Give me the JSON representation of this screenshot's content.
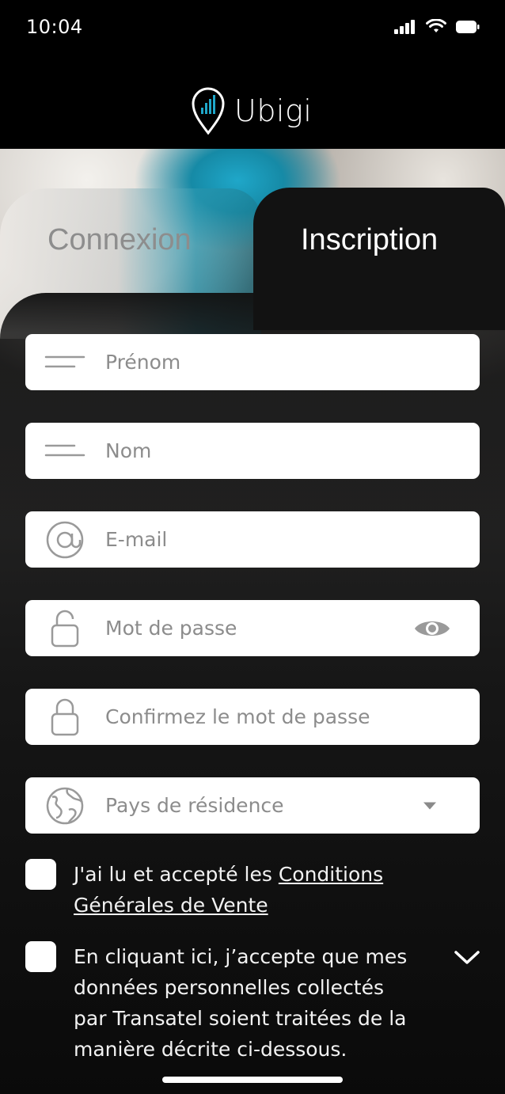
{
  "status_bar": {
    "time": "10:04",
    "icons": [
      "signal-icon",
      "wifi-icon",
      "battery-icon"
    ]
  },
  "header": {
    "logo_text": "Ubigi",
    "logo_icon": "location-pin-signal-icon"
  },
  "tabs": [
    {
      "label": "Connexion",
      "active": false
    },
    {
      "label": "Inscription",
      "active": true
    }
  ],
  "form": {
    "first_name": {
      "placeholder": "Prénom",
      "icon": "name-lines-icon"
    },
    "last_name": {
      "placeholder": "Nom",
      "icon": "name-lines-icon"
    },
    "email": {
      "placeholder": "E-mail",
      "icon": "at-sign-icon"
    },
    "password": {
      "placeholder": "Mot de passe",
      "icon": "unlock-icon",
      "toggle_icon": "eye-icon"
    },
    "confirm_password": {
      "placeholder": "Confirmez le mot de passe",
      "icon": "lock-icon"
    },
    "country": {
      "placeholder": "Pays de résidence",
      "icon": "globe-icon",
      "dropdown_icon": "caret-down-icon"
    }
  },
  "consents": {
    "terms": {
      "text_before": "J'ai lu et accepté les ",
      "link_line1": "Conditions",
      "link_line2": "Générales de Vente",
      "checked": false
    },
    "data": {
      "lines": [
        "En cliquant ici, j’accepte que mes",
        "données personnelles collectés",
        "par Transatel soient traitées de la",
        "manière décrite ci-dessous."
      ],
      "checked": false,
      "expand_icon": "chevron-down-icon"
    }
  },
  "colors": {
    "background": "#000000",
    "panel": "#121212",
    "field": "#ffffff",
    "placeholder": "#8c8c8c",
    "icon_gray": "#9a9a9a",
    "accent_teal": "#1fa7c9"
  }
}
